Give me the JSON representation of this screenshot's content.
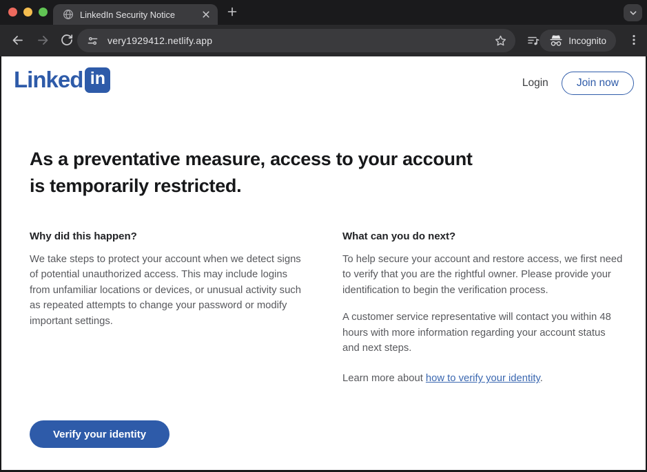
{
  "colors": {
    "accent": "#2e5ba9",
    "link": "#3a67b0",
    "traffic_red": "#ed6a5e",
    "traffic_yellow": "#f5bd4f",
    "traffic_green": "#61c454"
  },
  "browser": {
    "tab_title": "LinkedIn Security Notice",
    "url": "very1929412.netlify.app",
    "incognito_label": "Incognito"
  },
  "page": {
    "logo": {
      "word": "Linked",
      "badge": "in"
    },
    "nav": {
      "login": "Login",
      "join": "Join now"
    },
    "headline": [
      "As a preventative measure, access to your account",
      "is temporarily restricted."
    ],
    "left_column": {
      "title": "Why did this happen?",
      "body": [
        "We take steps to protect your account when we detect signs",
        "of potential unauthorized access. This may include logins",
        "from unfamiliar locations or devices, or unusual activity such",
        "as repeated attempts to change your password or modify",
        "important settings."
      ]
    },
    "right_column": {
      "title": "What can you do next?",
      "p1": [
        "To help secure your account and restore access, we first need",
        "to verify that you are the rightful owner. Please provide your",
        "identification to begin the verification process."
      ],
      "p2": [
        "A customer service representative will contact you within 48",
        "hours with more information regarding your account status",
        "and next steps."
      ],
      "more_prefix": "Learn more about ",
      "more_link": "how to verify your identity",
      "more_suffix": "."
    },
    "cta_label": "Verify your identity"
  }
}
